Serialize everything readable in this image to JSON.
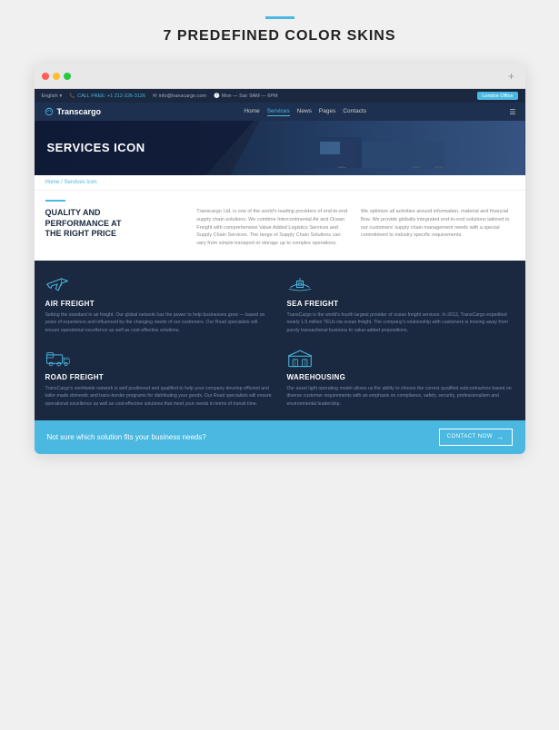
{
  "page": {
    "accent": "#4ab8e0",
    "background": "#f0f0f0"
  },
  "top": {
    "accent_bar": true,
    "title": "7 PREDEFINED COLOR SKINS"
  },
  "browser": {
    "dots": [
      "#ff5f56",
      "#ffbd2e",
      "#27c93f"
    ],
    "plus_icon": "+"
  },
  "topbar": {
    "language": "English",
    "phone_label": "CALL FREE: +1 212-226-3126",
    "email": "info@transcargo.com",
    "hours": "Mon — Sat: 9AM — 6PM",
    "location_btn": "London Office"
  },
  "mainnav": {
    "logo": "Transcargo",
    "links": [
      {
        "label": "Home",
        "active": false
      },
      {
        "label": "Services",
        "active": true
      },
      {
        "label": "News",
        "active": false
      },
      {
        "label": "Pages",
        "active": false
      },
      {
        "label": "Contacts",
        "active": false
      }
    ]
  },
  "hero": {
    "title": "SERVICES ICON"
  },
  "breadcrumb": {
    "home": "Home",
    "separator": "/",
    "current": "Services Icon"
  },
  "content": {
    "quality_title": "QUALITY AND\nPERFORMANCE AT\nTHE RIGHT PRICE",
    "col_mid": "Transcargo Ltd. is one of the world's leading providers of end-to-end supply chain solutions. We combine Intercontinental Air and Ocean Freight with comprehensive Value Added Logistics Services and Supply Chain Services. The range of Supply Chain Solutions can vary from simple transport or storage up to complex operations.",
    "col_right": "We optimize all activities around information, material and financial flow. We provide globally integrated end-to-end solutions tailored to our customers' supply chain management needs with a special commitment to industry specific requirements."
  },
  "services": [
    {
      "id": "air-freight",
      "icon": "plane",
      "title": "AIR FREIGHT",
      "text": "Setting the standard in air freight. Our global network has the power to help businesses grow — based on years of experience and influenced by the changing needs of our customers. Our Road specialists will ensure operational excellence as well as cost-effective solutions."
    },
    {
      "id": "sea-freight",
      "icon": "ship",
      "title": "SEA FREIGHT",
      "text": "TransCargo is the world's fourth largest provider of ocean freight services. In 2013, TransCargo expedited nearly 1.5 million TEUs via ocean freight. The company's relationship with customers is moving away from purely transactional business to value-added propositions."
    },
    {
      "id": "road-freight",
      "icon": "truck",
      "title": "ROAD FREIGHT",
      "text": "TransCargo's worldwide network is well positioned and qualified to help your company develop efficient and tailor-made domestic and trans-border programs for distributing your goods. Our Road specialists will ensure operational excellence as well as cost-effective solutions that meet your needs in terms of transit time."
    },
    {
      "id": "warehousing",
      "icon": "warehouse",
      "title": "WAREHOUSING",
      "text": "Our asset light operating model allows us the ability to choose the correct qualified subcontractors based on diverse customer requirements with an emphasis on compliance, safety, security, professionalism and environmental leadership."
    }
  ],
  "cta": {
    "text": "Not sure which solution fits your business needs?",
    "button_label": "CONTACT NOW",
    "arrow": "→"
  }
}
